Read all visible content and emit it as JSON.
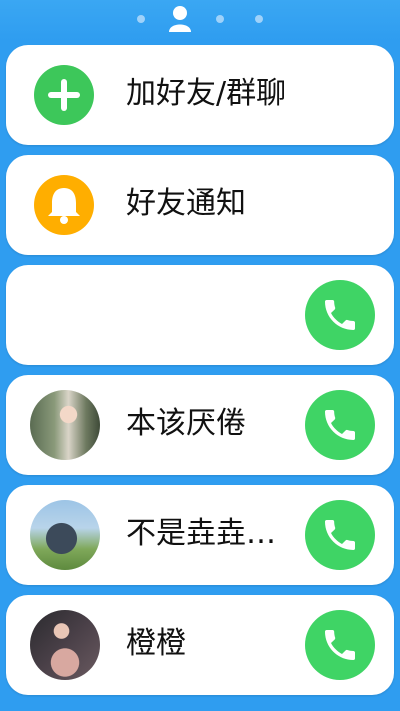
{
  "topbar": {
    "pager_dots": 3,
    "active_icon": "person-icon"
  },
  "colors": {
    "background": "#2f9df0",
    "add_icon": "#3dc75a",
    "notify_icon": "#ffae00",
    "call_button": "#3fd465"
  },
  "items": [
    {
      "label": "加好友/群聊",
      "icon": "plus-icon"
    },
    {
      "label": "好友通知",
      "icon": "bell-icon"
    },
    {
      "label": "",
      "icon": "phone-icon"
    },
    {
      "label": "本该厌倦",
      "icon": "avatar-photo"
    },
    {
      "label": "不是垚垚…",
      "icon": "avatar-photo"
    },
    {
      "label": "橙橙",
      "icon": "avatar-photo"
    }
  ]
}
